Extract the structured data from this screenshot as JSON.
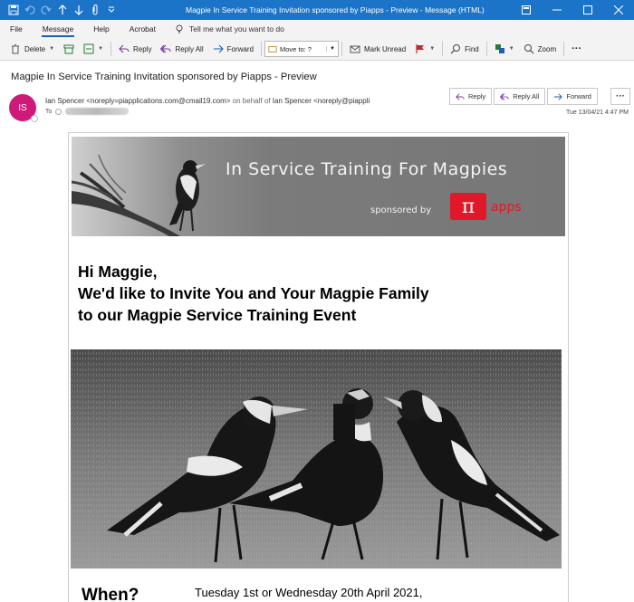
{
  "window": {
    "title": "Magpie In  Service Training Invitation sponsored by Piapps  -  Preview  -  Message (HTML)"
  },
  "menu": {
    "items": [
      "File",
      "Message",
      "Help",
      "Acrobat"
    ],
    "active": "Message",
    "tell_me": "Tell me what you want to do"
  },
  "ribbon": {
    "delete": "Delete",
    "reply": "Reply",
    "reply_all": "Reply All",
    "forward": "Forward",
    "move_to": "Move to: ?",
    "mark_unread": "Mark Unread",
    "find": "Find",
    "zoom": "Zoom",
    "more": "···"
  },
  "message": {
    "subject": "Magpie In  Service Training Invitation sponsored by Piapps - Preview",
    "avatar_initials": "IS",
    "from_name": "Ian Spencer <noreply=piapplications.com@cmail19.com>",
    "on_behalf": "on behalf of",
    "from_behalf": "Ian Spencer <noreply@piappli",
    "to_label": "To",
    "date": "Tue 13/04/21 4:47 PM",
    "actions": {
      "reply": "Reply",
      "reply_all": "Reply All",
      "forward": "Forward",
      "more": "···"
    }
  },
  "email": {
    "banner_title": "In Service Training For Magpies",
    "sponsored_by": "sponsored by",
    "pi_symbol": "π",
    "apps": "apps",
    "greeting_line1": "Hi Maggie,",
    "greeting_line2": "We'd like to Invite You and Your Magpie Family",
    "greeting_line3": "to our Magpie Service Training Event",
    "when_label": "When?",
    "when_value": "Tuesday 1st or Wednesday 20th April 2021,"
  },
  "colors": {
    "title_bar": "#1c74c8",
    "avatar": "#d01a7a",
    "brand_red": "#e0182a"
  }
}
